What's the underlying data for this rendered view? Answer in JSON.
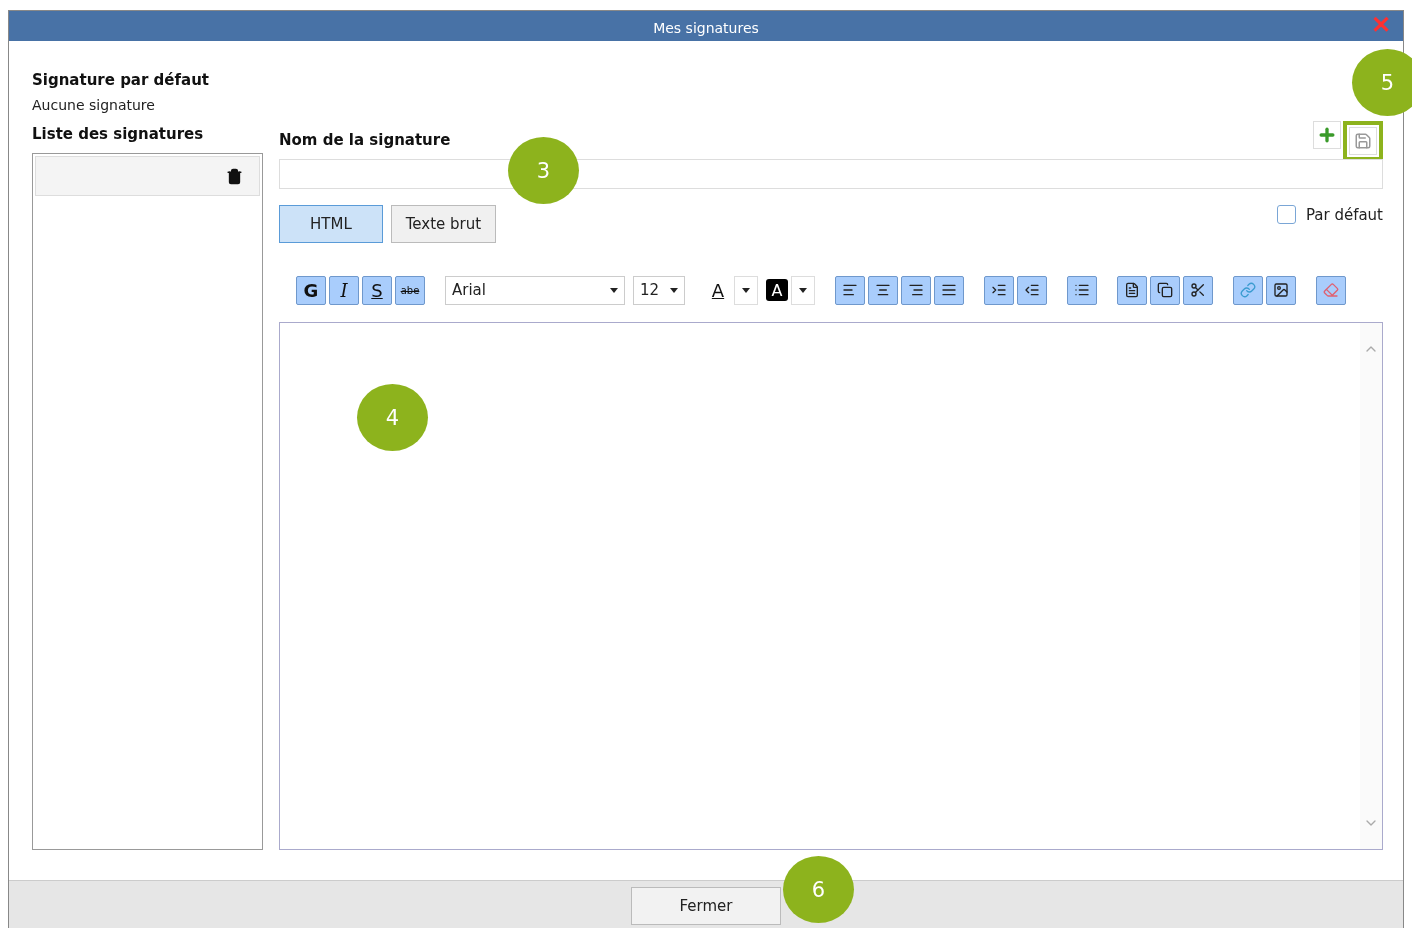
{
  "window": {
    "title": "Mes signatures",
    "close": "✕"
  },
  "default_signature": {
    "label": "Signature par défaut",
    "value": "Aucune signature"
  },
  "list": {
    "label": "Liste des signatures",
    "items": [
      {
        "selected": true
      }
    ]
  },
  "name_field": {
    "label": "Nom de la signature"
  },
  "save_highlighted": true,
  "modes": [
    {
      "label": "HTML",
      "selected": true
    },
    {
      "label": "Texte brut",
      "selected": false
    }
  ],
  "default_checkbox": {
    "label": "Par défaut",
    "checked": false
  },
  "format_buttons": [
    {
      "kind": "bold",
      "label": "G"
    },
    {
      "kind": "italic",
      "label": "I"
    },
    {
      "kind": "underline",
      "label": "S"
    },
    {
      "kind": "strike",
      "label": "abe"
    }
  ],
  "font": {
    "value": "Arial"
  },
  "size": {
    "value": "12"
  },
  "text_color": {
    "label": "A"
  },
  "back_color": {
    "label": "A"
  },
  "footer": {
    "close_button": "Fermer"
  },
  "callouts": [
    {
      "number": "3"
    },
    {
      "number": "4"
    },
    {
      "number": "5"
    },
    {
      "number": "6"
    }
  ]
}
